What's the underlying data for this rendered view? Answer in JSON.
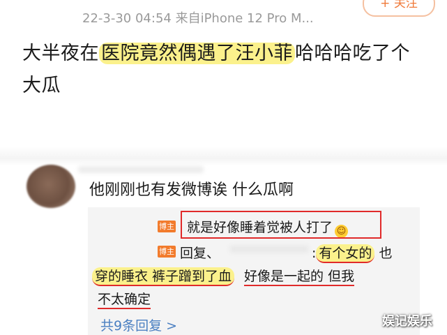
{
  "post": {
    "meta": "22-3-30 04:54  来自iPhone 12 Pro M...",
    "follow_label": "+ 关注",
    "text_before": "大半夜在",
    "text_highlight": "医院竟然偶遇了汪小菲",
    "text_after": "哈哈哈吃了个大瓜"
  },
  "comment": {
    "text": "他刚刚也有发微博诶 什么瓜啊"
  },
  "replies": {
    "badge_label": "博主",
    "reply1_text": "就是好像睡着觉被人打了",
    "reply2_prefix": "回复、",
    "reply2_colon": ":",
    "reply2_highlight": "有个女的",
    "reply2_tail": " 也",
    "reply3_highlight": "穿的睡衣 裤子蹭到了血",
    "reply3_rest": "好像是一起的 但我",
    "reply4_text": "不太确定",
    "more_link": "共9条回复 >"
  },
  "watermark": "娱记娱乐",
  "icons": {
    "emoji": "laughing-tears-emoji"
  },
  "colors": {
    "highlight": "#fbf18c",
    "annotation_red": "#e02a2a",
    "badge_orange": "#f27b2c",
    "link_blue": "#4a7fc1",
    "follow_orange": "#f07a3a"
  }
}
